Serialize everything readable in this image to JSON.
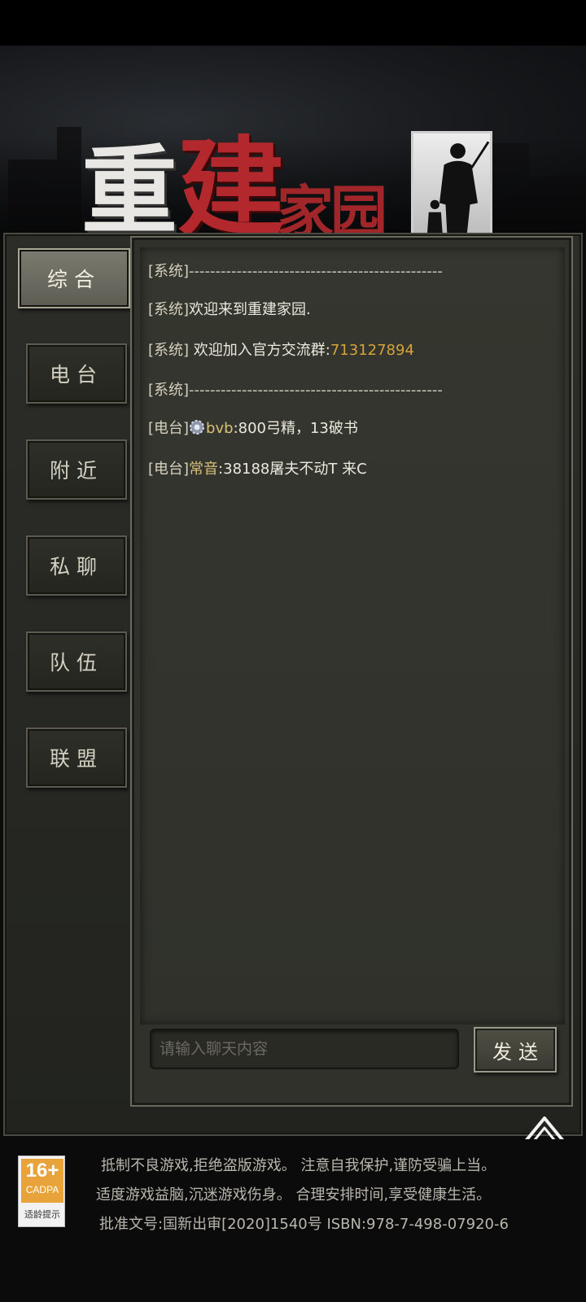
{
  "banner": {
    "logo_part1": "重",
    "logo_part2": "建",
    "logo_part3": "家园"
  },
  "tabs": [
    {
      "label": "综合",
      "active": true
    },
    {
      "label": "电台",
      "active": false
    },
    {
      "label": "附近",
      "active": false
    },
    {
      "label": "私聊",
      "active": false
    },
    {
      "label": "队伍",
      "active": false
    },
    {
      "label": "联盟",
      "active": false
    }
  ],
  "chat": {
    "messages": [
      {
        "channel": "[系统]",
        "text": "------------------------------------------------"
      },
      {
        "channel": "[系统]",
        "text": "欢迎来到重建家园."
      },
      {
        "channel": "[系统]",
        "text": " 欢迎加入官方交流群:",
        "highlight": "713127894"
      },
      {
        "channel": "[系统]",
        "text": "------------------------------------------------"
      },
      {
        "channel": "[电台]",
        "name": "bvb",
        "text": ":800弓精，13破书"
      },
      {
        "channel": "[电台]",
        "name": "常音",
        "text": ":38188屠夫不动T 来C"
      }
    ],
    "input_placeholder": "请输入聊天内容",
    "send_label": "发送"
  },
  "footer": {
    "age_rating": "16+",
    "rating_org": "CADPA",
    "rating_tip": "适龄提示",
    "line1": "抵制不良游戏,拒绝盗版游戏。 注意自我保护,谨防受骗上当。",
    "line2": "适度游戏益脑,沉迷游戏伤身。 合理安排时间,享受健康生活。",
    "line3": "批准文号:国新出审[2020]1540号    ISBN:978-7-498-07920-6"
  },
  "colors": {
    "highlight": "#d6a23a",
    "player_name": "#d6c07a",
    "logo_red": "#b3282c",
    "badge_orange": "#e8a43b"
  }
}
